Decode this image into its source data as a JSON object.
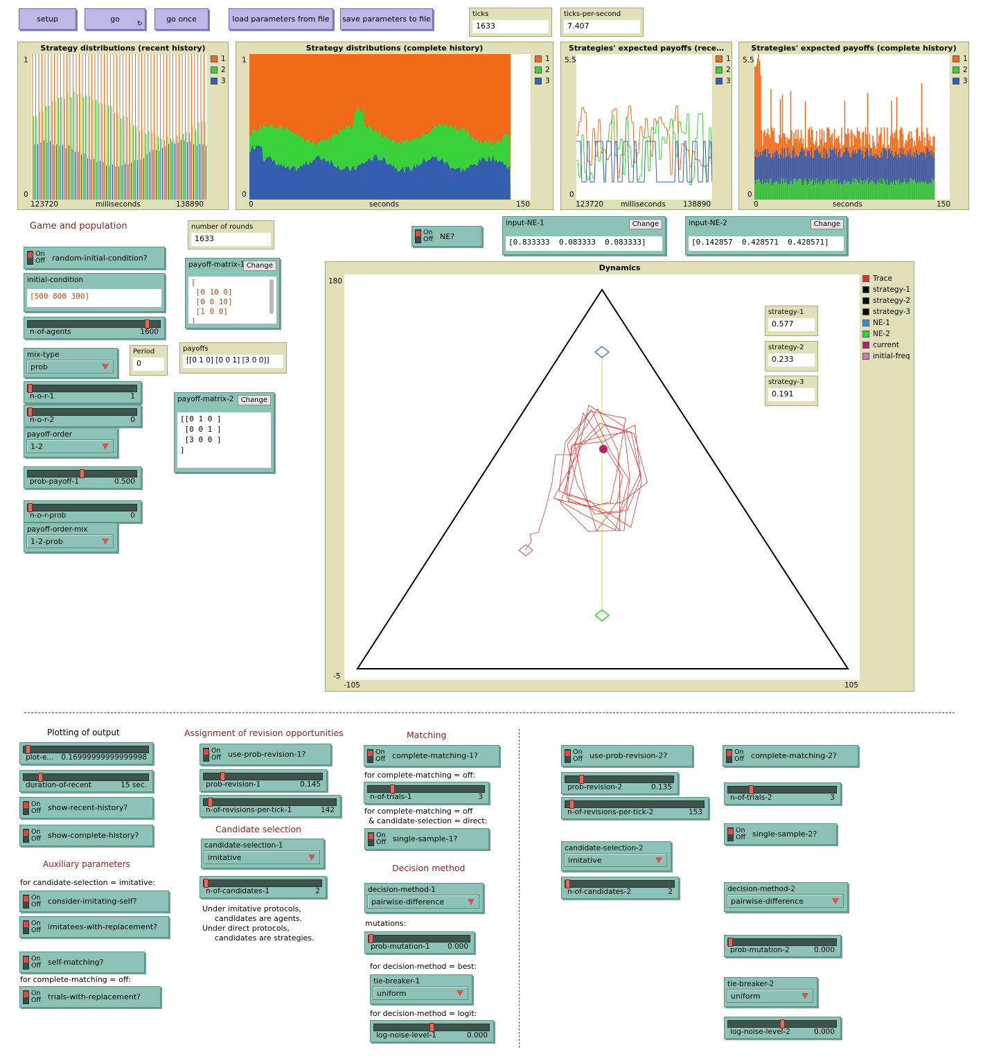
{
  "buttons": {
    "setup": "setup",
    "go": "go",
    "go_once": "go once",
    "load": "load parameters from file",
    "save": "save parameters to file"
  },
  "monitors": {
    "ticks_label": "ticks",
    "ticks": "1633",
    "tps_label": "ticks-per-second",
    "tps": "7.407",
    "rounds_label": "number of rounds",
    "rounds": "1633",
    "period_label": "Period",
    "period": "0",
    "payoffs_label": "payoffs",
    "payoffs": "[[0 1 0] [0 0 1] [3 0 0]]",
    "s1_label": "strategy-1",
    "s1": "0.577",
    "s2_label": "strategy-2",
    "s2": "0.233",
    "s3_label": "strategy-3",
    "s3": "0.191"
  },
  "plots": {
    "p1": {
      "title": "Strategy distributions (recent history)",
      "ymax": "1",
      "ymin": "0",
      "xmin": "123720",
      "xlabel": "milliseconds",
      "xmax": "138890"
    },
    "p2": {
      "title": "Strategy distributions (complete history)",
      "ymax": "1",
      "ymin": "0",
      "xmin": "0",
      "xlabel": "seconds",
      "xmax": "150"
    },
    "p3": {
      "title": "Strategies' expected payoffs (rece…",
      "ymax": "5.5",
      "ymin": "0",
      "xmin": "123720",
      "xlabel": "milliseconds",
      "xmax": "138890"
    },
    "p4": {
      "title": "Strategies' expected payoffs (complete history)",
      "ymax": "5.5",
      "ymin": "0",
      "xmin": "0",
      "xlabel": "seconds",
      "xmax": "150"
    },
    "dyn": {
      "title": "Dynamics",
      "ymax": "180",
      "ymin": "-5",
      "xmin": "-105",
      "xmax": "105"
    }
  },
  "legend_small": [
    "1",
    "2",
    "3"
  ],
  "series_colors": {
    "1": "#f06b1a",
    "2": "#3ad13a",
    "3": "#355dae"
  },
  "dyn_legend": [
    {
      "label": "Trace",
      "color": "#d83a32"
    },
    {
      "label": "strategy-1",
      "color": "#000000"
    },
    {
      "label": "strategy-2",
      "color": "#000000"
    },
    {
      "label": "strategy-3",
      "color": "#000000"
    },
    {
      "label": "NE-1",
      "color": "#3d8fd0"
    },
    {
      "label": "NE-2",
      "color": "#3ad13a"
    },
    {
      "label": "current",
      "color": "#b2216e"
    },
    {
      "label": "initial-freq",
      "color": "#d77ab3"
    }
  ],
  "heads": {
    "game": "Game and population",
    "plotting": "Plotting of output",
    "aux": "Auxiliary parameters",
    "assign": "Assignment of revision opportunities",
    "cand": "Candidate selection",
    "matching": "Matching",
    "decision": "Decision method"
  },
  "switches": {
    "on": "On",
    "off": "Off",
    "random_ic": "random-initial-condition?",
    "ne": "NE?",
    "show_recent": "show-recent-history?",
    "show_complete": "show-complete-history?",
    "imitate_self": "consider-imitating-self?",
    "imitatees": "imitatees-with-replacement?",
    "self_matching": "self-matching?",
    "trials_repl": "trials-with-replacement?",
    "prob_rev1": "use-prob-revision-1?",
    "complete1": "complete-matching-1?",
    "single1": "single-sample-1?",
    "prob_rev2": "use-prob-revision-2?",
    "complete2": "complete-matching-2?",
    "single2": "single-sample-2?"
  },
  "sliders": {
    "n_agents": {
      "name": "n-of-agents",
      "value": "1600",
      "fraction": 0.92
    },
    "nor1": {
      "name": "n-o-r-1",
      "value": "1",
      "fraction": 0.0
    },
    "nor2": {
      "name": "n-o-r-2",
      "value": "0",
      "fraction": 0.0
    },
    "prob_payoff": {
      "name": "prob-payoff-1",
      "value": "0.500",
      "fraction": 0.5
    },
    "nor_prob": {
      "name": "n-o-r-prob",
      "value": "0",
      "fraction": 0.0
    },
    "plot_every": {
      "name": "plot-e...",
      "value": "0.16999999999999998",
      "fraction": 0.02
    },
    "duration": {
      "name": "duration-of-recent",
      "value": "15 sec.",
      "fraction": 0.12
    },
    "prob_rev1": {
      "name": "prob-revision-1",
      "value": "0.145",
      "fraction": 0.145
    },
    "nrev1": {
      "name": "n-of-revisions-per-tick-1",
      "value": "142",
      "fraction": 0.03
    },
    "ncand1": {
      "name": "n-of-candidates-1",
      "value": "2",
      "fraction": 0.0
    },
    "ntrials1": {
      "name": "n-of-trials-1",
      "value": "3",
      "fraction": 0.2
    },
    "pmut1": {
      "name": "prob-mutation-1",
      "value": "0.000",
      "fraction": 0.0
    },
    "noise1": {
      "name": "log-noise-level-1",
      "value": "0.000",
      "fraction": 0.5
    },
    "prob_rev2": {
      "name": "prob-revision-2",
      "value": "0.135",
      "fraction": 0.135
    },
    "nrev2": {
      "name": "n-of-revisions-per-tick-2",
      "value": "153",
      "fraction": 0.03
    },
    "ncand2": {
      "name": "n-of-candidates-2",
      "value": "2",
      "fraction": 0.0
    },
    "ntrials2": {
      "name": "n-of-trials-2",
      "value": "3",
      "fraction": 0.2
    },
    "pmut2": {
      "name": "prob-mutation-2",
      "value": "0.000",
      "fraction": 0.0
    },
    "noise2": {
      "name": "log-noise-level-2",
      "value": "0.000",
      "fraction": 0.5
    }
  },
  "choosers": {
    "mix": {
      "label": "mix-type",
      "value": "prob"
    },
    "order": {
      "label": "payoff-order",
      "value": "1-2"
    },
    "order_mix": {
      "label": "payoff-order-mix",
      "value": "1-2-prob"
    },
    "cand1": {
      "label": "candidate-selection-1",
      "value": "imitative"
    },
    "dec1": {
      "label": "decision-method-1",
      "value": "pairwise-difference"
    },
    "tie1": {
      "label": "tie-breaker-1",
      "value": "uniform"
    },
    "cand2": {
      "label": "candidate-selection-2",
      "value": "imitative"
    },
    "dec2": {
      "label": "decision-method-2",
      "value": "pairwise-difference"
    },
    "tie2": {
      "label": "tie-breaker-2",
      "value": "uniform"
    }
  },
  "inputs": {
    "ic_label": "initial-condition",
    "ic": "[500 800 300]",
    "pm1_label": "payoff-matrix-1",
    "pm1": "[\n [0 10 0]\n [0 0 10]\n [1 0 0]\n]",
    "pm2_label": "payoff-matrix-2",
    "pm2": "[[0 1 0 ]\n [0 0 1 ]\n [3 0 0 ]\n]",
    "ne1_label": "input-NE-1",
    "ne1": "[0.833333  0.083333  0.083333]",
    "ne2_label": "input-NE-2",
    "ne2": "[0.142857  0.428571  0.428571]",
    "change": "Change"
  },
  "notes": {
    "for_imitative": "for candidate-selection = imitative:",
    "for_complete_off": "for complete-matching = off:",
    "for_complete_off1": "for complete-matching = off:",
    "for_complete_direct1": "for complete-matching = off",
    "for_complete_direct2": "& candidate-selection = direct:",
    "mutations": "mutations:",
    "for_best": "for decision-method = best:",
    "for_logit": "for decision-method = logit:",
    "imit1": "Under imitative protocols,",
    "imit2": "candidates are agents.",
    "dir1": "Under direct protocols,",
    "dir2": "candidates are strategies."
  }
}
